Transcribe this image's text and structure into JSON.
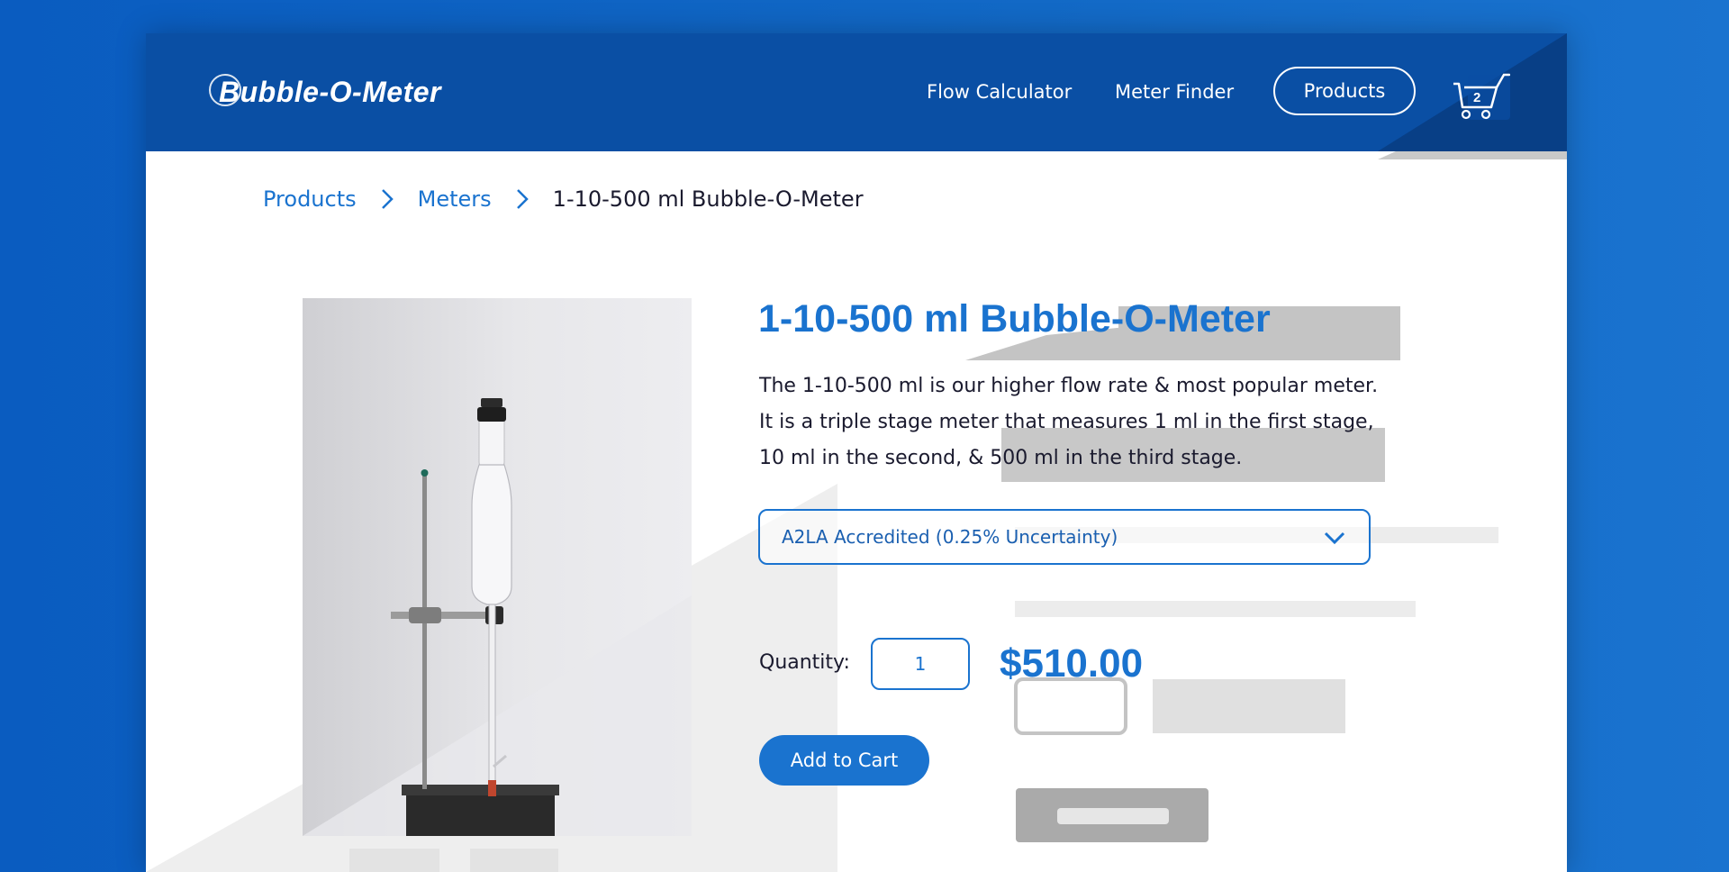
{
  "brand": {
    "logo_text": "Bubble-O-Meter"
  },
  "nav": {
    "flow_calculator": "Flow Calculator",
    "meter_finder": "Meter Finder",
    "products": "Products",
    "cart_count": "2"
  },
  "breadcrumb": {
    "items": [
      "Products",
      "Meters"
    ],
    "current": "1-10-500 ml Bubble-O-Meter"
  },
  "product": {
    "title": "1-10-500 ml Bubble-O-Meter",
    "description_lines": [
      "The 1-10-500 ml is our higher flow rate & most popular meter.",
      "It is a triple stage meter that measures 1 ml in the first stage,",
      "10 ml in the second, & 500 ml in the third stage."
    ],
    "option_selected": "A2LA Accredited (0.25% Uncertainty)",
    "quantity_label": "Quantity:",
    "quantity_value": "1",
    "price": "$510.00",
    "add_to_cart": "Add to Cart"
  },
  "colors": {
    "brand_blue": "#1a73cf",
    "header_blue": "#0a4fa4",
    "background_blue": "#1269c6"
  },
  "icons": [
    "logo-ring-icon",
    "chevron-right-icon",
    "cart-icon",
    "chevron-down-icon"
  ]
}
